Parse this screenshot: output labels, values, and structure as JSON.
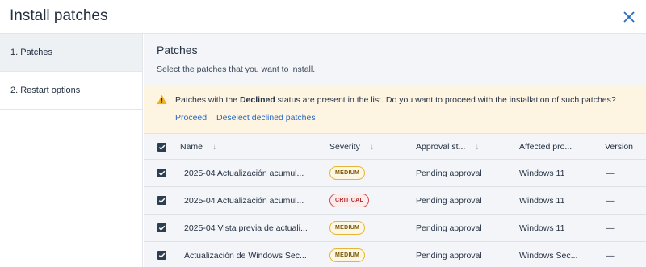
{
  "window": {
    "title": "Install patches"
  },
  "sidebar": {
    "steps": [
      {
        "label": "1. Patches"
      },
      {
        "label": "2. Restart options"
      }
    ]
  },
  "main": {
    "title": "Patches",
    "subtitle": "Select the patches that you want to install."
  },
  "alert": {
    "text_before": "Patches with the ",
    "text_bold": "Declined",
    "text_after": " status are present in the list. Do you want to proceed with the installation of such patches?",
    "proceed_label": "Proceed",
    "deselect_label": "Deselect declined patches"
  },
  "table": {
    "columns": {
      "name": "Name",
      "severity": "Severity",
      "approval": "Approval st...",
      "affected": "Affected pro...",
      "version": "Version"
    },
    "rows": [
      {
        "name": "2025-04 Actualización acumul...",
        "severity": "MEDIUM",
        "approval": "Pending approval",
        "affected": "Windows 11",
        "version": "—"
      },
      {
        "name": "2025-04 Actualización acumul...",
        "severity": "CRITICAL",
        "approval": "Pending approval",
        "affected": "Windows 11",
        "version": "—"
      },
      {
        "name": "2025-04 Vista previa de actuali...",
        "severity": "MEDIUM",
        "approval": "Pending approval",
        "affected": "Windows 11",
        "version": "—"
      },
      {
        "name": "Actualización de Windows Sec...",
        "severity": "MEDIUM",
        "approval": "Pending approval",
        "affected": "Windows Sec...",
        "version": "—"
      }
    ]
  },
  "icons": {
    "close": "close-icon",
    "warning": "warning-icon",
    "check": "checkmark-icon",
    "sort": "sort-down-icon"
  },
  "colors": {
    "link": "#2668c5",
    "alert_bg": "#fdf5e2",
    "medium_border": "#e5b53b",
    "critical_border": "#d64a4a",
    "checkbox": "#2c3e50"
  }
}
